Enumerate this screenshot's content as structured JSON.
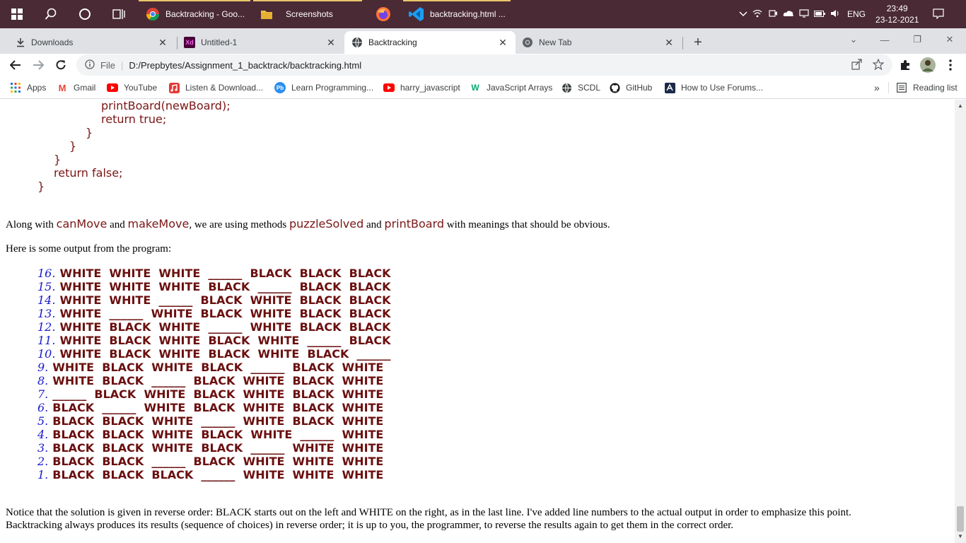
{
  "taskbar": {
    "apps": [
      {
        "label": "Backtracking - Goo...",
        "icon": "chrome-icon"
      },
      {
        "label": "Screenshots",
        "icon": "folder-icon"
      },
      {
        "label": "",
        "icon": "firefox-icon"
      },
      {
        "label": "backtracking.html ...",
        "icon": "vscode-icon"
      }
    ],
    "tray": {
      "language": "ENG",
      "time": "23:49",
      "date": "23-12-2021"
    }
  },
  "tabs": [
    {
      "title": "Downloads",
      "icon": "download-icon"
    },
    {
      "title": "Untitled-1",
      "icon": "adobe-xd-icon",
      "icon_text": "Xd"
    },
    {
      "title": "Backtracking",
      "icon": "globe-icon"
    },
    {
      "title": "New Tab",
      "icon": "chrome-icon"
    }
  ],
  "address": {
    "scheme_label": "File",
    "url": "D:/Prepbytes/Assignment_1_backtrack/backtracking.html"
  },
  "bookmarks": [
    {
      "label": "Apps",
      "icon": "apps-grid-icon"
    },
    {
      "label": "Gmail",
      "icon": "gmail-icon",
      "icon_text": "M"
    },
    {
      "label": "YouTube",
      "icon": "youtube-icon"
    },
    {
      "label": "Listen & Download...",
      "icon": "music-icon"
    },
    {
      "label": "Learn Programming...",
      "icon": "prepbytes-icon",
      "icon_text": "Pb"
    },
    {
      "label": "harry_javascript",
      "icon": "youtube-icon"
    },
    {
      "label": "JavaScript Arrays",
      "icon": "w3schools-icon",
      "icon_text": "W"
    },
    {
      "label": "SCDL",
      "icon": "globe-icon"
    },
    {
      "label": "GitHub",
      "icon": "github-icon"
    },
    {
      "label": "How to Use Forums...",
      "icon": "forum-icon"
    }
  ],
  "bookmarks_overflow": "»",
  "reading_list": "Reading list",
  "code": [
    "printBoard(newBoard);",
    "return true;",
    "}",
    "}",
    "}",
    "return false;",
    "}"
  ],
  "paragraph1": {
    "t1": "Along with ",
    "c1": "canMove",
    "t2": " and ",
    "c2": "makeMove",
    "t3": ", we are using methods ",
    "c3": "puzzleSolved",
    "t4": " and ",
    "c4": "printBoard",
    "t5": " with meanings that should be obvious."
  },
  "paragraph2": "Here is some output from the program:",
  "output": [
    {
      "num": "16.",
      "text": "WHITE  WHITE  WHITE  ______  BLACK  BLACK  BLACK"
    },
    {
      "num": "15.",
      "text": "WHITE  WHITE  WHITE  BLACK  ______  BLACK  BLACK"
    },
    {
      "num": "14.",
      "text": "WHITE  WHITE  ______  BLACK  WHITE  BLACK  BLACK"
    },
    {
      "num": "13.",
      "text": "WHITE  ______  WHITE  BLACK  WHITE  BLACK  BLACK"
    },
    {
      "num": "12.",
      "text": "WHITE  BLACK  WHITE  ______  WHITE  BLACK  BLACK"
    },
    {
      "num": "11.",
      "text": "WHITE  BLACK  WHITE  BLACK  WHITE  ______  BLACK"
    },
    {
      "num": "10.",
      "text": "WHITE  BLACK  WHITE  BLACK  WHITE  BLACK  ______"
    },
    {
      "num": "9.",
      "text": "WHITE  BLACK  WHITE  BLACK  ______  BLACK  WHITE"
    },
    {
      "num": "8.",
      "text": "WHITE  BLACK  ______  BLACK  WHITE  BLACK  WHITE"
    },
    {
      "num": "7.",
      "text": "______  BLACK  WHITE  BLACK  WHITE  BLACK  WHITE"
    },
    {
      "num": "6.",
      "text": "BLACK  ______  WHITE  BLACK  WHITE  BLACK  WHITE"
    },
    {
      "num": "5.",
      "text": "BLACK  BLACK  WHITE  ______  WHITE  BLACK  WHITE"
    },
    {
      "num": "4.",
      "text": "BLACK  BLACK  WHITE  BLACK  WHITE  ______  WHITE"
    },
    {
      "num": "3.",
      "text": "BLACK  BLACK  WHITE  BLACK  ______  WHITE  WHITE"
    },
    {
      "num": "2.",
      "text": "BLACK  BLACK  ______  BLACK  WHITE  WHITE  WHITE"
    },
    {
      "num": "1.",
      "text": "BLACK  BLACK  BLACK  ______  WHITE  WHITE  WHITE"
    }
  ],
  "paragraph3": {
    "line1": "Notice that the solution is given in reverse order: BLACK starts out on the left and WHITE on the right, as in the last line. I've added line numbers to the actual output in order to emphasize this point.",
    "line2": "Backtracking always produces its results (sequence of choices) in reverse order; it is up to you, the programmer, to reverse the results again to get them in the correct order."
  }
}
